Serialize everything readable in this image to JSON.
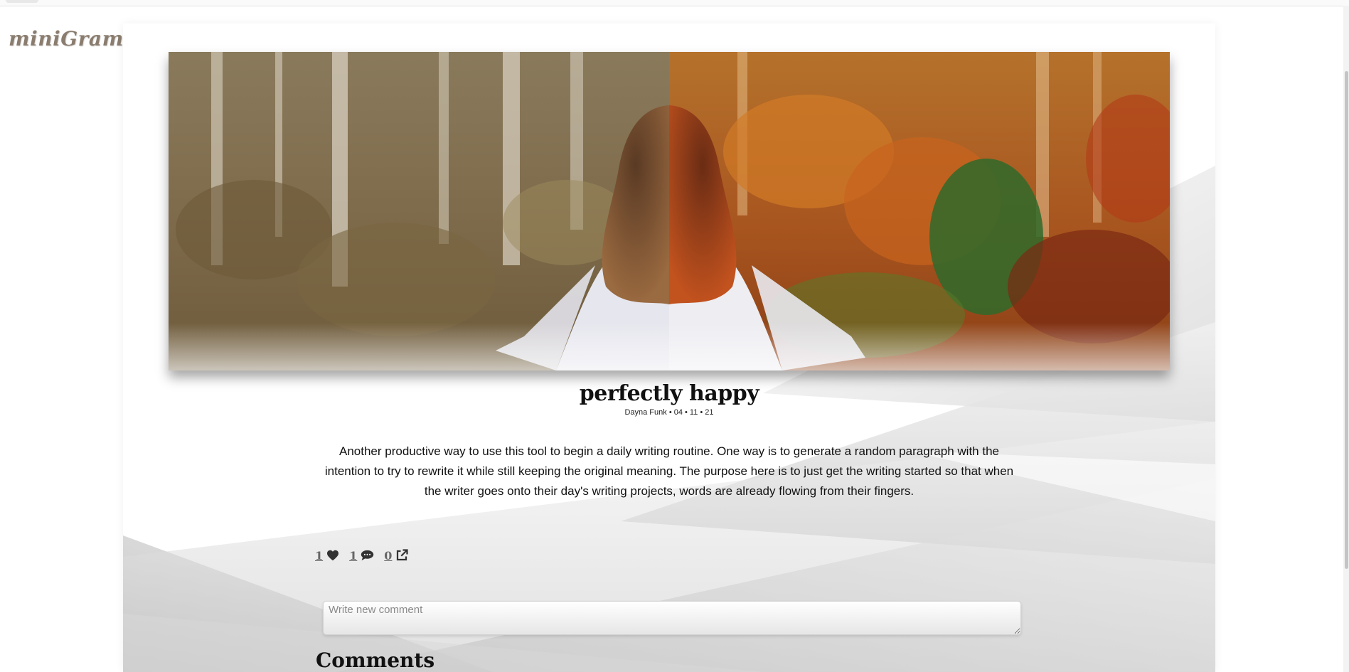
{
  "app": {
    "logo": "miniGram"
  },
  "post": {
    "title": "perfectly happy",
    "meta": "Dayna Funk • 04 • 11 • 21",
    "body": "Another productive way to use this tool to begin a daily writing routine. One way is to generate a random paragraph with the intention to try to rewrite it while still keeping the original meaning. The purpose here is to just get the writing started so that when the writer goes onto their day's writing projects, words are already flowing from their fingers.",
    "actions": {
      "likes": "1",
      "comments": "1",
      "shares": "0"
    }
  },
  "comment_form": {
    "placeholder": "Write new comment"
  },
  "comments": {
    "heading": "Comments"
  },
  "colors": {
    "logo": "#8a7c6e",
    "action_icon": "#333333",
    "action_count": "#666666"
  },
  "icons": {
    "like": "heart-icon",
    "comment": "speech-bubble-icon",
    "share": "external-link-icon"
  }
}
